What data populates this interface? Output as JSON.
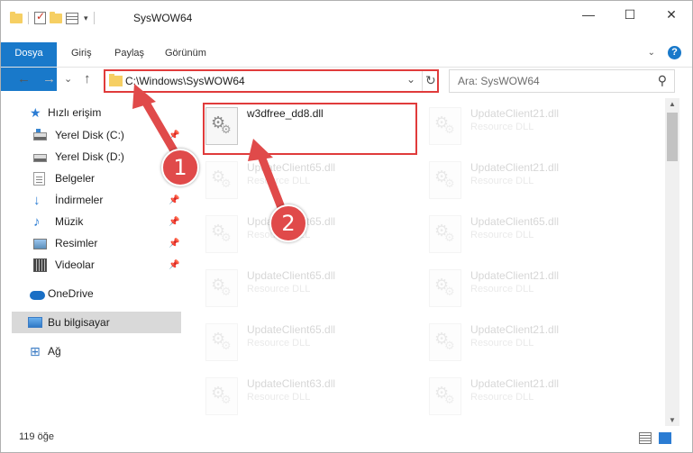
{
  "window": {
    "title": "SysWOW64",
    "buttons": {
      "minimize": "—",
      "maximize": "☐",
      "close": "✕"
    }
  },
  "ribbon": {
    "tabs": [
      "Dosya",
      "Giriş",
      "Paylaş",
      "Görünüm"
    ],
    "help": "?"
  },
  "nav": {
    "back": "←",
    "forward": "→",
    "recent": "⌄",
    "up": "↑",
    "address": "C:\\Windows\\SysWOW64",
    "search_placeholder": "Ara: SysWOW64"
  },
  "sidebar": {
    "items": [
      {
        "label": "Hızlı erişim",
        "icon": "star-icon"
      },
      {
        "label": "Yerel Disk (C:)",
        "icon": "drive-c-icon",
        "pinned": true
      },
      {
        "label": "Yerel Disk (D:)",
        "icon": "drive-icon"
      },
      {
        "label": "Belgeler",
        "icon": "documents-icon"
      },
      {
        "label": "İndirmeler",
        "icon": "downloads-icon",
        "pinned": true
      },
      {
        "label": "Müzik",
        "icon": "music-icon",
        "pinned": true
      },
      {
        "label": "Resimler",
        "icon": "pictures-icon",
        "pinned": true
      },
      {
        "label": "Videolar",
        "icon": "videos-icon",
        "pinned": true
      },
      {
        "label": "OneDrive",
        "icon": "onedrive-icon"
      },
      {
        "label": "Bu bilgisayar",
        "icon": "this-pc-icon",
        "selected": true
      },
      {
        "label": "Ağ",
        "icon": "network-icon"
      }
    ]
  },
  "files": {
    "highlighted": {
      "name": "w3dfree_dd8.dll",
      "type": ""
    },
    "left_column": [
      {
        "name": "UpdateClient65.dll",
        "type": "Resource DLL"
      },
      {
        "name": "UpdateClient65.dll",
        "type": "Resource DLL"
      },
      {
        "name": "UpdateClient65.dll",
        "type": "Resource DLL"
      },
      {
        "name": "UpdateClient65.dll",
        "type": "Resource DLL"
      },
      {
        "name": "UpdateClient63.dll",
        "type": "Resource DLL"
      }
    ],
    "right_column": [
      {
        "name": "UpdateClient21.dll",
        "type": "Resource DLL"
      },
      {
        "name": "UpdateClient21.dll",
        "type": "Resource DLL"
      },
      {
        "name": "UpdateClient65.dll",
        "type": "Resource DLL"
      },
      {
        "name": "UpdateClient21.dll",
        "type": "Resource DLL"
      },
      {
        "name": "UpdateClient21.dll",
        "type": "Resource DLL"
      },
      {
        "name": "UpdateClient21.dll",
        "type": "Resource DLL"
      }
    ]
  },
  "status": {
    "item_count": "119 öğe"
  },
  "annotations": {
    "step1": "1",
    "step2": "2",
    "color": "#e04a4a"
  }
}
